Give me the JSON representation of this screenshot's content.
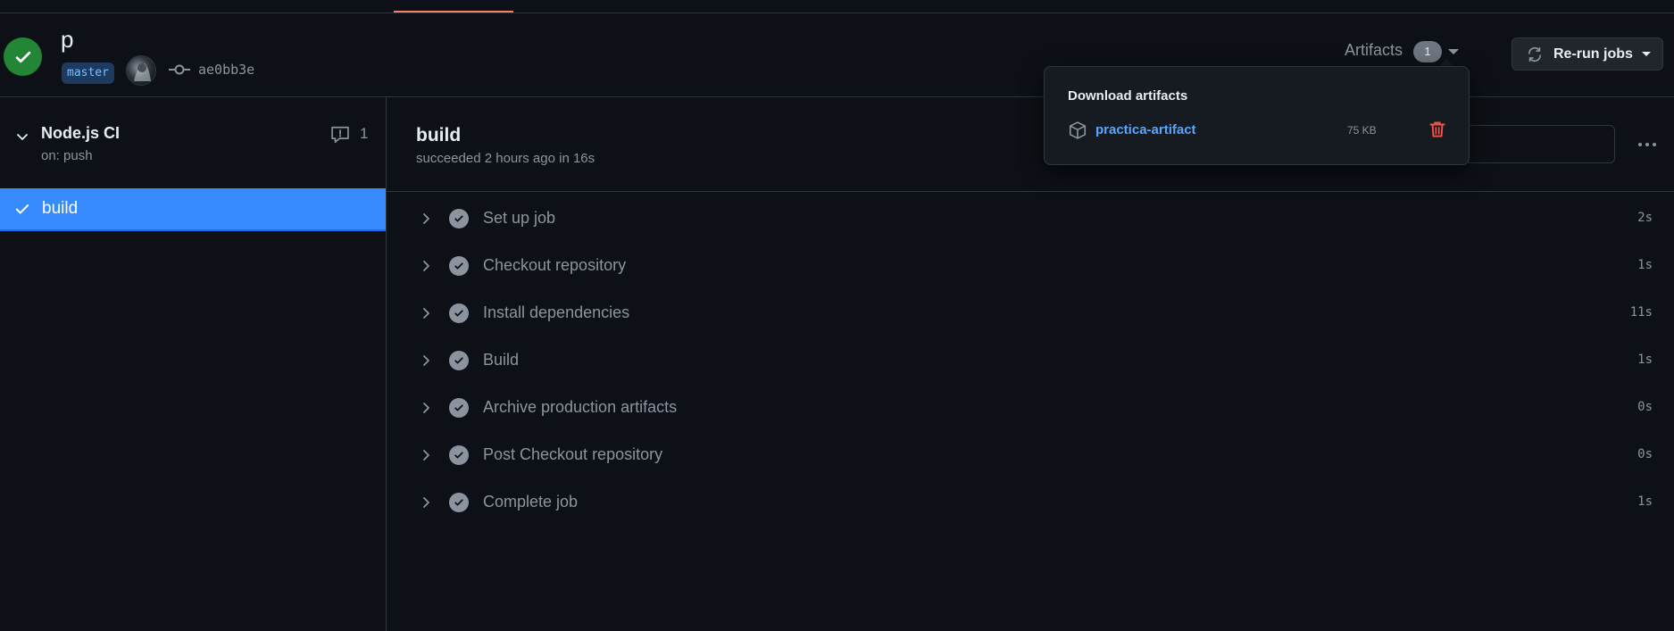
{
  "run": {
    "title": "p",
    "branch": "master",
    "commit_sha": "ae0bb3e"
  },
  "artifacts": {
    "label": "Artifacts",
    "count": "1",
    "popover_title": "Download artifacts",
    "items": [
      {
        "name": "practica-artifact",
        "size": "75 KB"
      }
    ]
  },
  "rerun": {
    "label": "Re-run jobs"
  },
  "sidebar": {
    "workflow": {
      "name": "Node.js CI",
      "trigger": "on: push",
      "annotations": "1"
    },
    "jobs": [
      {
        "label": "build"
      }
    ]
  },
  "job": {
    "title": "build",
    "meta": "succeeded 2 hours ago in 16s",
    "steps": [
      {
        "name": "Set up job",
        "duration": "2s"
      },
      {
        "name": "Checkout repository",
        "duration": "1s"
      },
      {
        "name": "Install dependencies",
        "duration": "11s"
      },
      {
        "name": "Build",
        "duration": "1s"
      },
      {
        "name": "Archive production artifacts",
        "duration": "0s"
      },
      {
        "name": "Post Checkout repository",
        "duration": "0s"
      },
      {
        "name": "Complete job",
        "duration": "1s"
      }
    ]
  },
  "colors": {
    "success": "#238636",
    "accent": "#388bfd",
    "link": "#58a6ff",
    "danger": "#f85149",
    "tab_underline": "#f78166"
  }
}
